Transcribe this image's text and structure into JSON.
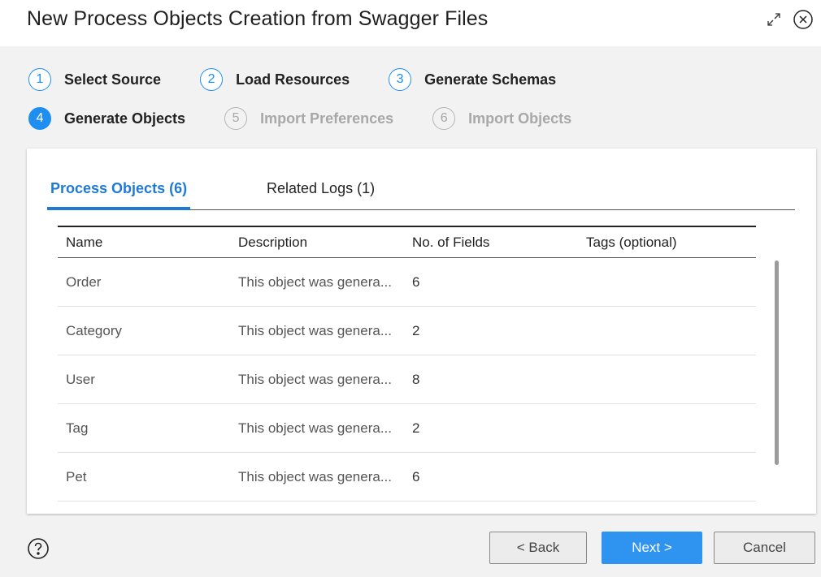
{
  "dialog": {
    "title": "New Process Objects Creation from Swagger Files",
    "maximize_icon": "expand-icon",
    "close_icon": "close-circle-icon"
  },
  "steps": [
    {
      "num": "1",
      "label": "Select Source",
      "state": "done"
    },
    {
      "num": "2",
      "label": "Load Resources",
      "state": "done"
    },
    {
      "num": "3",
      "label": "Generate Schemas",
      "state": "done"
    },
    {
      "num": "4",
      "label": "Generate Objects",
      "state": "active"
    },
    {
      "num": "5",
      "label": "Import Preferences",
      "state": "pending"
    },
    {
      "num": "6",
      "label": "Import Objects",
      "state": "pending"
    }
  ],
  "tabs": [
    {
      "label": "Process Objects (6)",
      "active": true
    },
    {
      "label": "Related Logs (1)",
      "active": false
    }
  ],
  "table": {
    "headers": [
      "Name",
      "Description",
      "No. of Fields",
      "Tags (optional)"
    ],
    "rows": [
      {
        "name": "Order",
        "description": "This object was genera...",
        "fields": "6",
        "tags": ""
      },
      {
        "name": "Category",
        "description": "This object was genera...",
        "fields": "2",
        "tags": ""
      },
      {
        "name": "User",
        "description": "This object was genera...",
        "fields": "8",
        "tags": ""
      },
      {
        "name": "Tag",
        "description": "This object was genera...",
        "fields": "2",
        "tags": ""
      },
      {
        "name": "Pet",
        "description": "This object was genera...",
        "fields": "6",
        "tags": ""
      }
    ]
  },
  "footer": {
    "help_icon": "help-icon",
    "back_label": "< Back",
    "next_label": "Next >",
    "cancel_label": "Cancel"
  },
  "colors": {
    "accent": "#1f8ef1",
    "tab_active": "#1f7ad6",
    "pending": "#a8a8a8"
  }
}
